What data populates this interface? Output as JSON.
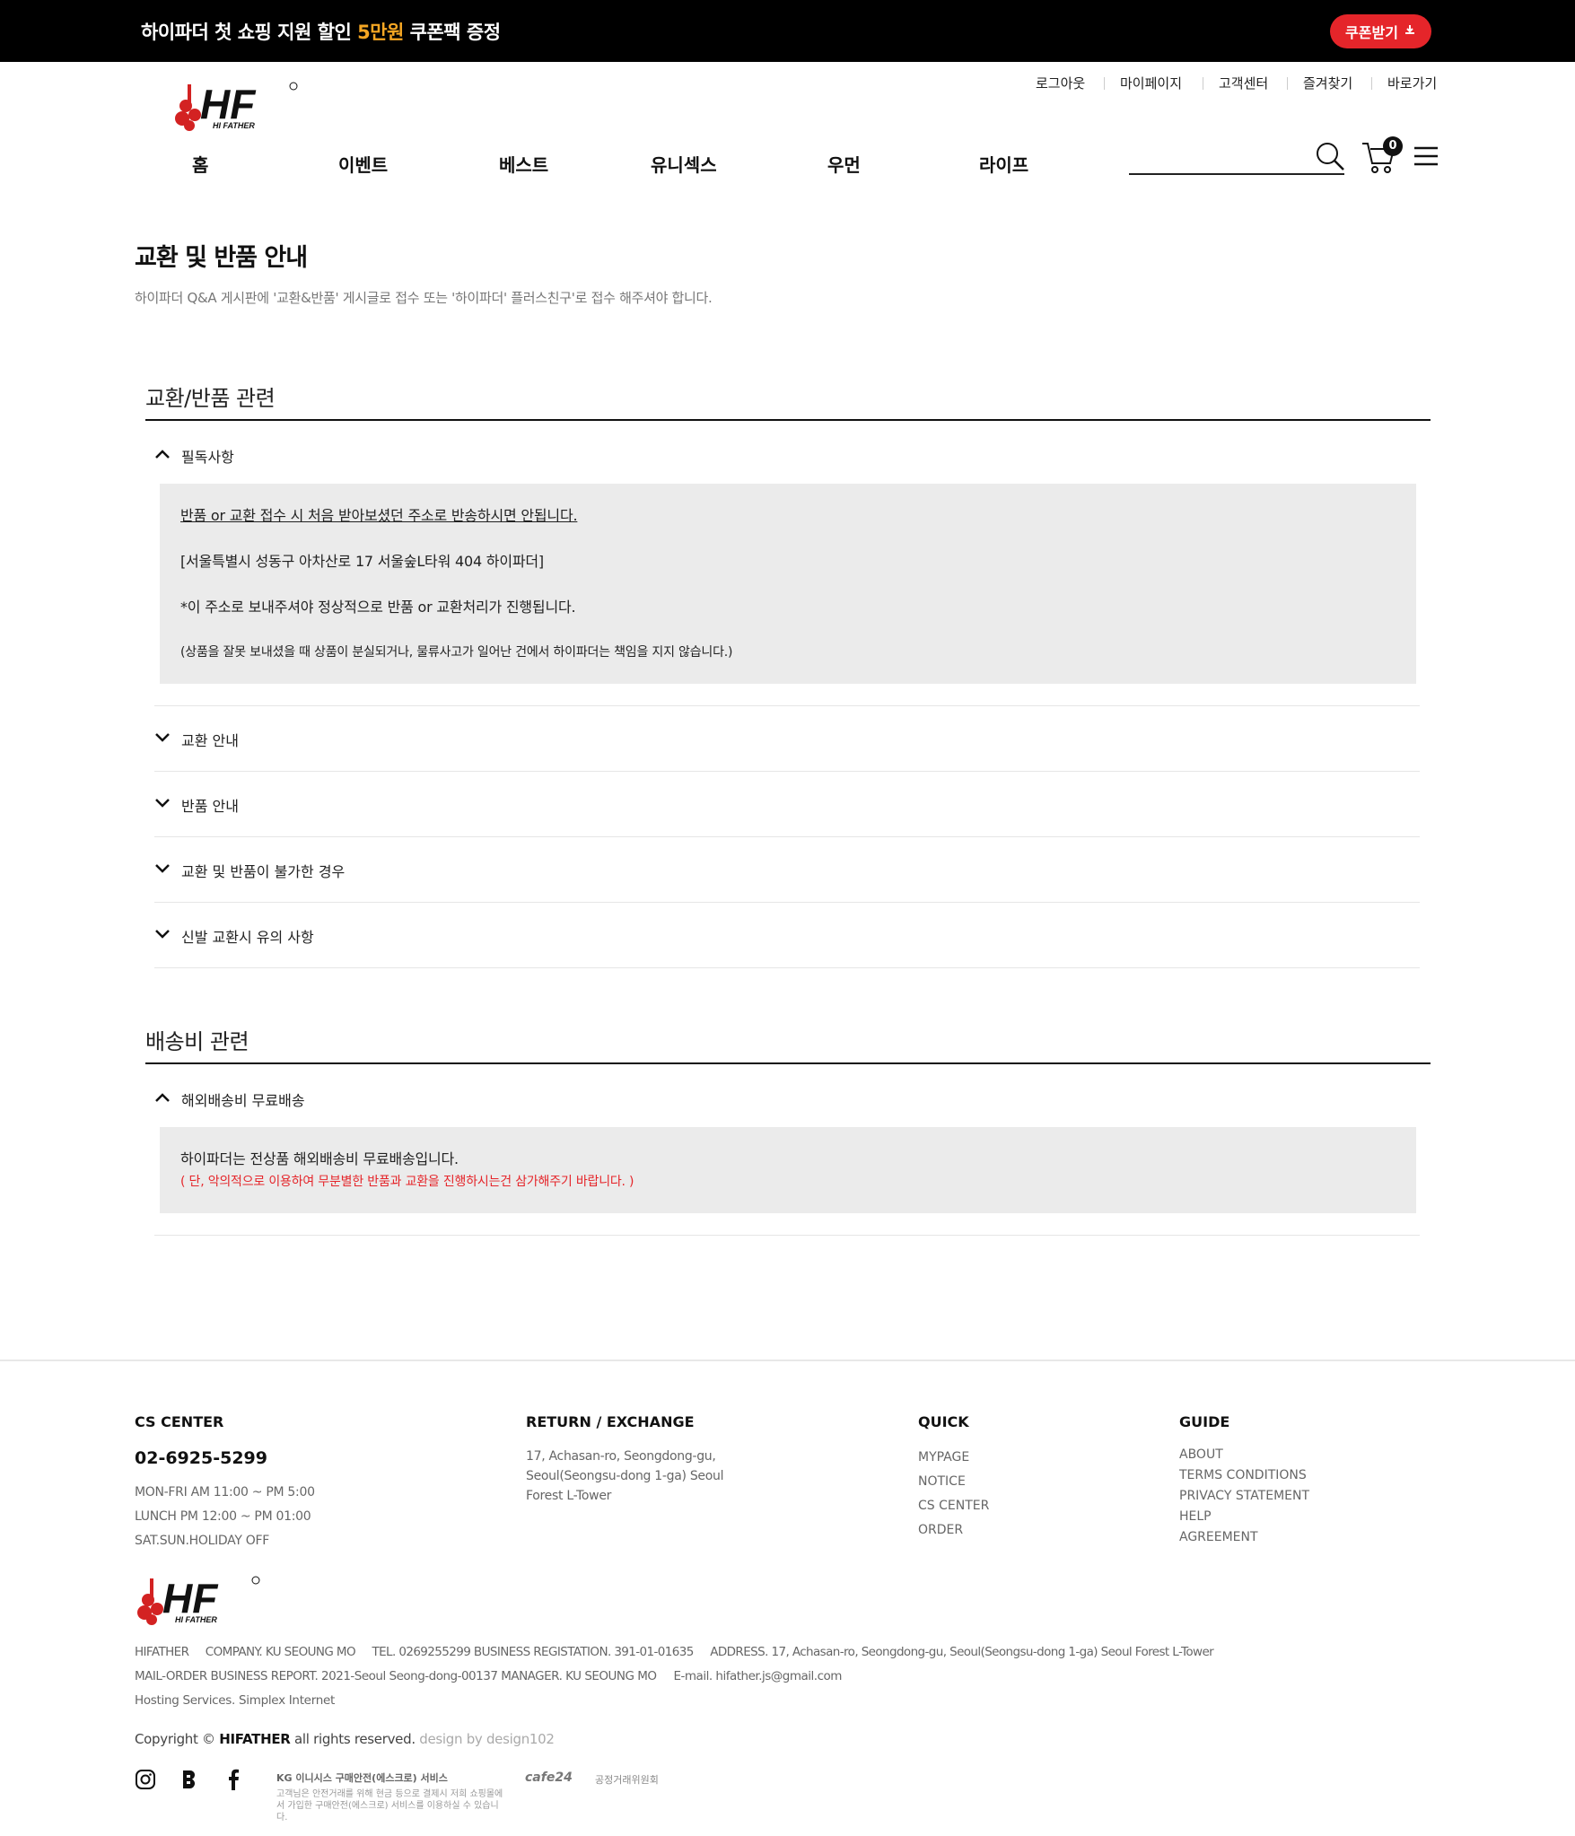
{
  "topbar": {
    "text_before": "하이파더 첫 쇼핑 지원 할인 ",
    "text_highlight": "5만원",
    "text_after": " 쿠폰팩 증정",
    "coupon_button": "쿠폰받기",
    "coupon_icon": "download-icon",
    "highlight_color": "#f5a623",
    "button_color": "#e5252a"
  },
  "header": {
    "util_links": [
      "로그아웃",
      "마이페이지",
      "고객센터",
      "즐겨찾기",
      "바로가기"
    ],
    "logo_text": "HF",
    "logo_sub": "HI FATHER",
    "nav": [
      "홈",
      "이벤트",
      "베스트",
      "유니섹스",
      "우먼",
      "라이프"
    ],
    "search_placeholder": "",
    "cart_count": "0"
  },
  "main": {
    "title": "교환 및 반품 안내",
    "subtitle": "하이파더 Q&A 게시판에 '교환&반품' 게시글로 접수 또는 '하이파더' 플러스친구'로 접수 해주셔야 합니다.",
    "sections": [
      {
        "title": "교환/반품 관련",
        "items": [
          {
            "label": "필독사항",
            "open": true,
            "lines": [
              "반품 or 교환 접수 시 처음 받아보셨던 주소로 반송하시면 안됩니다.",
              "[서울특별시 성동구 아차산로 17 서울숲L타워 404 하이파더]",
              "*이 주소로 보내주셔야 정상적으로 반품 or 교환처리가 진행됩니다.",
              "(상품을 잘못 보내셨을 때 상품이 분실되거나, 물류사고가 일어난 건에서 하이파더는 책임을 지지 않습니다.)"
            ]
          },
          {
            "label": "교환 안내",
            "open": false
          },
          {
            "label": "반품 안내",
            "open": false
          },
          {
            "label": "교환 및 반품이 불가한 경우",
            "open": false
          },
          {
            "label": "신발 교환시 유의 사항",
            "open": false
          }
        ]
      },
      {
        "title": "배송비 관련",
        "items": [
          {
            "label": "해외배송비 무료배송",
            "open": true,
            "lines": [
              "하이파더는 전상품 해외배송비 무료배송입니다.",
              "( 단, 악의적으로 이용하여 무분별한 반품과 교환을 진행하시는건 삼가해주기 바랍니다. )"
            ]
          }
        ]
      }
    ],
    "warning_color": "#e5252a"
  },
  "footer": {
    "cs": {
      "title": "CS CENTER",
      "phone": "02-6925-5299",
      "hours": [
        "MON-FRI AM 11:00 ~ PM 5:00",
        "LUNCH PM 12:00 ~ PM 01:00",
        "SAT.SUN.HOLIDAY OFF"
      ]
    },
    "return": {
      "title": "RETURN / EXCHANGE",
      "address": [
        "17, Achasan-ro, Seongdong-gu,",
        "Seoul(Seongsu-dong 1-ga) Seoul",
        "Forest L-Tower"
      ]
    },
    "quick": {
      "title": "QUICK",
      "links": [
        "MYPAGE",
        "NOTICE",
        "CS CENTER",
        "ORDER"
      ]
    },
    "guide": {
      "title": "GUIDE",
      "links": [
        "ABOUT",
        "TERMS CONDITIONS",
        "PRIVACY STATEMENT",
        "HELP",
        "AGREEMENT"
      ]
    },
    "company_lines": [
      "HIFATHER     COMPANY. KU SEOUNG MO     TEL. 0269255299 BUSINESS REGISTATION. 391-01-01635     ADDRESS. 17, Achasan-ro, Seongdong-gu, Seoul(Seongsu-dong 1-ga) Seoul Forest L-Tower",
      "MAIL-ORDER BUSINESS REPORT. 2021-Seoul Seong-dong-00137 MANAGER. KU SEOUNG MO     E-mail. hifather.js@gmail.com",
      "Hosting Services. Simplex Internet"
    ],
    "copyright_pre": "Copyright © ",
    "copyright_brand": "HIFATHER",
    "copyright_post": " all rights reserved.",
    "design_credit": "design by design102",
    "badges": {
      "kg": "KG 이니시스 구매안전(에스크로) 서비스",
      "kg_sub": "고객님은 안전거래를 위해 현금 등으로 결제시 저희 쇼핑몰에서 가입한 구매안전(에스크로) 서비스를 이용하실 수 있습니다.",
      "cafe24": "cafe24",
      "ftc": "공정거래위원회"
    }
  }
}
